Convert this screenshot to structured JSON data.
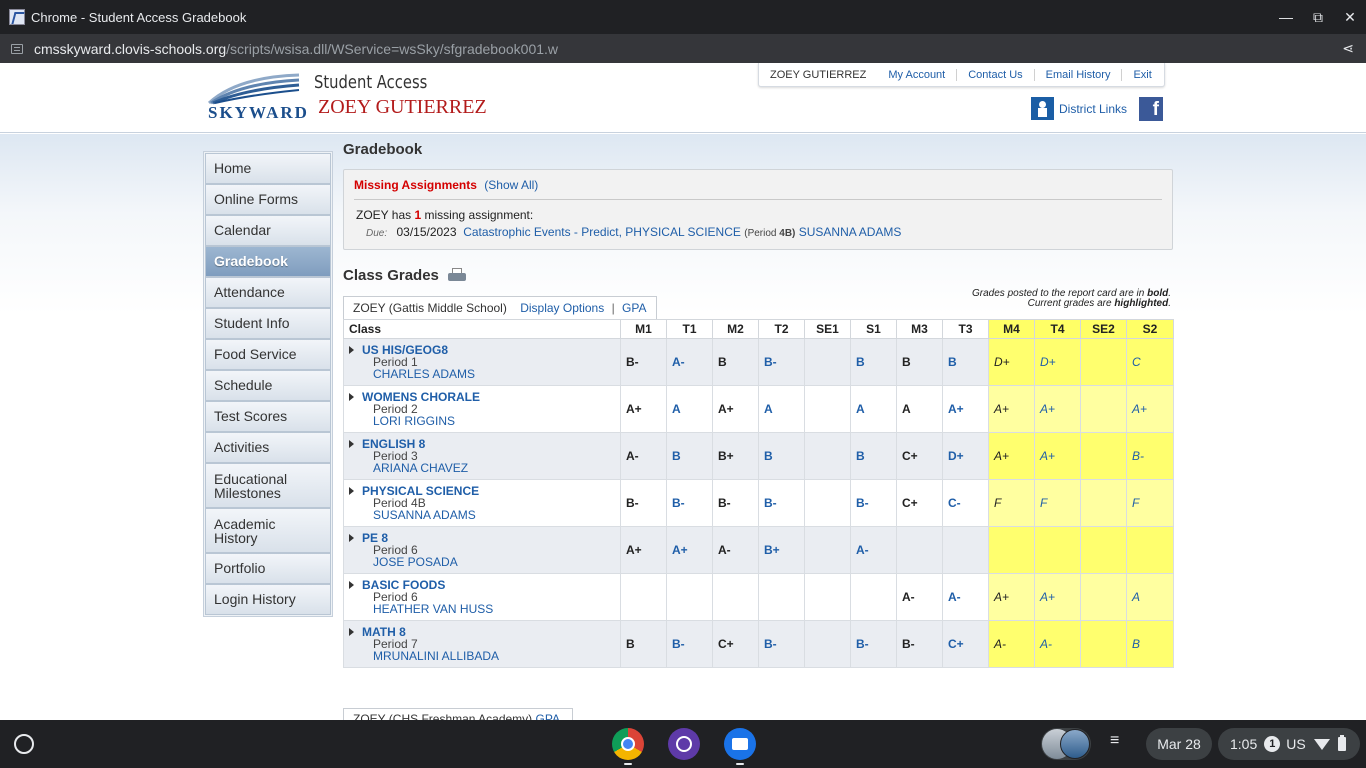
{
  "window": {
    "title": "Chrome - Student Access Gradebook",
    "controls": {
      "minimize": "—",
      "maximize": "⧉",
      "close": "✕"
    }
  },
  "urlbar": {
    "host": "cmsskyward.clovis-schools.org",
    "path": "/scripts/wsisa.dll/WService=wsSky/sfgradebook001.w"
  },
  "header": {
    "logo_text": "SKYWARD",
    "product": "Student Access",
    "student_name": "ZOEY GUTIERREZ",
    "user_nav": {
      "user": "ZOEY GUTIERREZ",
      "links": [
        "My Account",
        "Contact Us",
        "Email History",
        "Exit"
      ]
    },
    "district_links": "District Links",
    "facebook": "f"
  },
  "sidebar": {
    "items": [
      {
        "label": "Home",
        "active": false
      },
      {
        "label": "Online Forms",
        "active": false
      },
      {
        "label": "Calendar",
        "active": false
      },
      {
        "label": "Gradebook",
        "active": true
      },
      {
        "label": "Attendance",
        "active": false
      },
      {
        "label": "Student Info",
        "active": false
      },
      {
        "label": "Food Service",
        "active": false
      },
      {
        "label": "Schedule",
        "active": false
      },
      {
        "label": "Test Scores",
        "active": false
      },
      {
        "label": "Activities",
        "active": false
      },
      {
        "label": "Educational Milestones",
        "active": false
      },
      {
        "label": "Academic History",
        "active": false
      },
      {
        "label": "Portfolio",
        "active": false
      },
      {
        "label": "Login History",
        "active": false
      }
    ]
  },
  "main": {
    "title": "Gradebook",
    "missing": {
      "title": "Missing Assignments",
      "show_all": "(Show All)",
      "summary_prefix": "ZOEY has",
      "count": "1",
      "summary_suffix": "missing assignment:",
      "due_label": "Due:",
      "due_date": "03/15/2023",
      "assignment": "Catastrophic Events - Predict",
      "course": "PHYSICAL SCIENCE",
      "period_label": "(Period",
      "period_value": "4B)",
      "teacher": "SUSANNA ADAMS"
    },
    "class_grades_title": "Class Grades",
    "legend_line1_prefix": "Grades posted to the report card are in",
    "legend_line1_bold": "bold",
    "legend_line2_prefix": "Current grades are",
    "legend_line2_bold": "highlighted",
    "tab": {
      "school": "ZOEY (Gattis Middle School)",
      "display_options": "Display Options",
      "separator": "|",
      "gpa": "GPA"
    },
    "columns": [
      "Class",
      "M1",
      "T1",
      "M2",
      "T2",
      "SE1",
      "S1",
      "M3",
      "T3",
      "M4",
      "T4",
      "SE2",
      "S2"
    ],
    "highlighted_columns": [
      "M4",
      "T4",
      "SE2",
      "S2"
    ],
    "rows": [
      {
        "name": "US HIS/GEOG8",
        "period": "1",
        "teacher": "CHARLES ADAMS",
        "grades": [
          "B-",
          "A-",
          "B",
          "B-",
          "",
          "B",
          "B",
          "B",
          "D+",
          "D+",
          "",
          "C"
        ]
      },
      {
        "name": "WOMENS CHORALE",
        "period": "2",
        "teacher": "LORI RIGGINS",
        "grades": [
          "A+",
          "A",
          "A+",
          "A",
          "",
          "A",
          "A",
          "A+",
          "A+",
          "A+",
          "",
          "A+"
        ]
      },
      {
        "name": "ENGLISH 8",
        "period": "3",
        "teacher": "ARIANA CHAVEZ",
        "grades": [
          "A-",
          "B",
          "B+",
          "B",
          "",
          "B",
          "C+",
          "D+",
          "A+",
          "A+",
          "",
          "B-"
        ]
      },
      {
        "name": "PHYSICAL SCIENCE",
        "period": "4B",
        "teacher": "SUSANNA ADAMS",
        "grades": [
          "B-",
          "B-",
          "B-",
          "B-",
          "",
          "B-",
          "C+",
          "C-",
          "F",
          "F",
          "",
          "F"
        ]
      },
      {
        "name": "PE 8",
        "period": "6",
        "teacher": "JOSE POSADA",
        "grades": [
          "A+",
          "A+",
          "A-",
          "B+",
          "",
          "A-",
          "",
          "",
          "",
          "",
          "",
          ""
        ]
      },
      {
        "name": "BASIC FOODS",
        "period": "6",
        "teacher": "HEATHER VAN HUSS",
        "grades": [
          "",
          "",
          "",
          "",
          "",
          "",
          "A-",
          "A-",
          "A+",
          "A+",
          "",
          "A"
        ]
      },
      {
        "name": "MATH 8",
        "period": "7",
        "teacher": "MRUNALINI ALLIBADA",
        "grades": [
          "B",
          "B-",
          "C+",
          "B-",
          "",
          "B-",
          "B-",
          "C+",
          "A-",
          "A-",
          "",
          "B"
        ]
      }
    ],
    "period_label": "Period",
    "next_tab": {
      "school": "ZOEY (CHS Freshman Academy)",
      "gpa": "GPA"
    }
  },
  "shelf": {
    "date": "Mar 28",
    "time": "1:05",
    "notifications": "1",
    "locale": "US"
  }
}
